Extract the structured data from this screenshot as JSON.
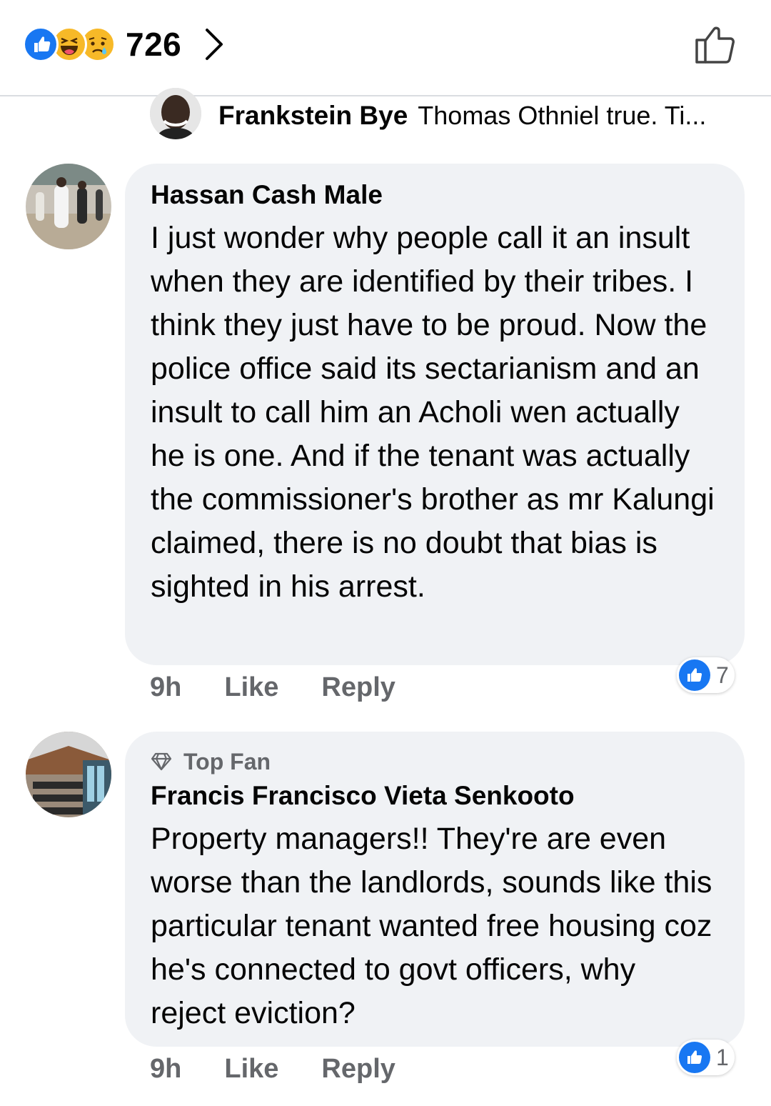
{
  "top_bar": {
    "reaction_count": "726",
    "reaction_icons": [
      "like-icon",
      "haha-icon",
      "sad-icon"
    ],
    "chevron_icon": "chevron-right-icon",
    "like_button_icon": "thumbs-up-outline-icon"
  },
  "reply_preview": {
    "author": "Frankstein Bye",
    "text": "Thomas Othniel true. Ti..."
  },
  "comments": [
    {
      "author": "Hassan Cash Male",
      "text": "I just wonder why people call it an insult when they are identified by their tribes. I think they just have to be proud.  Now the police office said its sectarianism and an insult to call him an Acholi wen actually he is one. And if the tenant was actually the commissioner's brother as mr Kalungi claimed, there is no doubt that bias is sighted in his arrest.",
      "time": "9h",
      "like_label": "Like",
      "reply_label": "Reply",
      "reaction_count": "7"
    },
    {
      "badge": "Top Fan",
      "author": "Francis Francisco Vieta Senkooto",
      "text": "Property managers!! They're are even worse than the landlords, sounds like this particular tenant wanted free housing coz he's connected to govt officers, why reject eviction?",
      "time": "9h",
      "like_label": "Like",
      "reply_label": "Reply",
      "reaction_count": "1"
    }
  ],
  "colors": {
    "facebook_blue": "#1877f2",
    "bubble_bg": "#f0f2f5",
    "meta_gray": "#65676b",
    "divider": "#dadde1"
  }
}
